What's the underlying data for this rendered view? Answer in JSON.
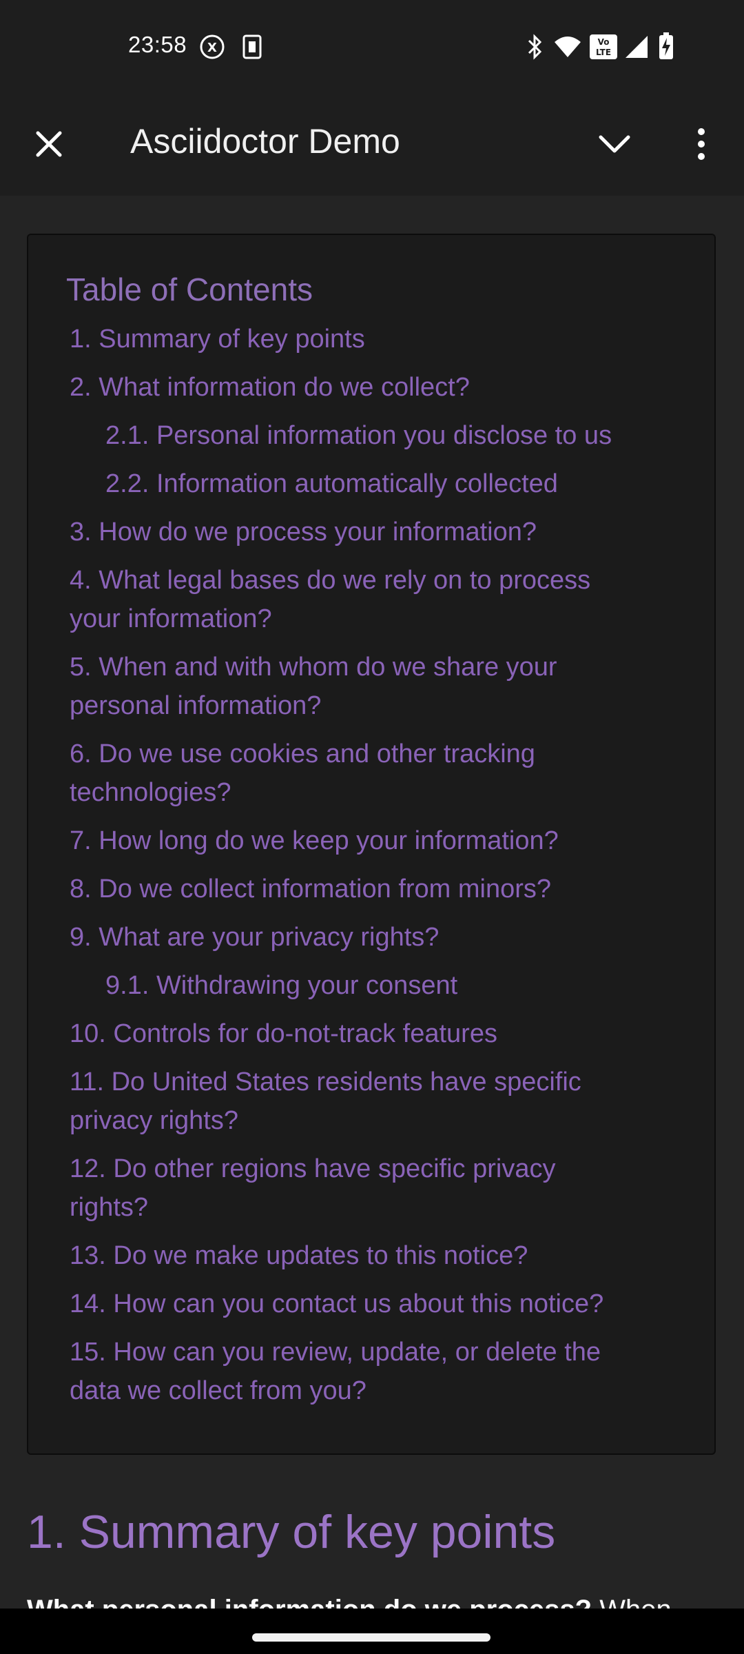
{
  "status_bar": {
    "time": "23:58",
    "volte_text": "Vo LTE"
  },
  "app_bar": {
    "title": "Asciidoctor Demo"
  },
  "toc": {
    "title": "Table of Contents",
    "items": [
      {
        "label": "1. Summary of key points"
      },
      {
        "label": "2. What information do we collect?"
      },
      {
        "label": "2.1. Personal information you disclose to us"
      },
      {
        "label": "2.2. Information automatically collected"
      },
      {
        "label": "3. How do we process your information?"
      },
      {
        "label": "4. What legal bases do we rely on to process"
      },
      {
        "label": "your information?"
      },
      {
        "label": "5. When and with whom do we share your"
      },
      {
        "label": "personal information?"
      },
      {
        "label": "6. Do we use cookies and other tracking"
      },
      {
        "label": "technologies?"
      },
      {
        "label": "7. How long do we keep your information?"
      },
      {
        "label": "8. Do we collect information from minors?"
      },
      {
        "label": "9. What are your privacy rights?"
      },
      {
        "label": "9.1. Withdrawing your consent"
      },
      {
        "label": "10. Controls for do-not-track features"
      },
      {
        "label": "11. Do United States residents have specific"
      },
      {
        "label": "privacy rights?"
      },
      {
        "label": "12. Do other regions have specific privacy"
      },
      {
        "label": "rights?"
      },
      {
        "label": "13. Do we make updates to this notice?"
      },
      {
        "label": "14. How can you contact us about this notice?"
      },
      {
        "label": "15. How can you review, update, or delete the"
      },
      {
        "label": "data we collect from you?"
      }
    ]
  },
  "section": {
    "heading": "1. Summary of key points",
    "partial_bold": "What personal information do we process?",
    "partial_rest": " When"
  },
  "colors": {
    "link": "#8a63b8",
    "background": "#242424",
    "toc_background": "#1b1b1b"
  }
}
